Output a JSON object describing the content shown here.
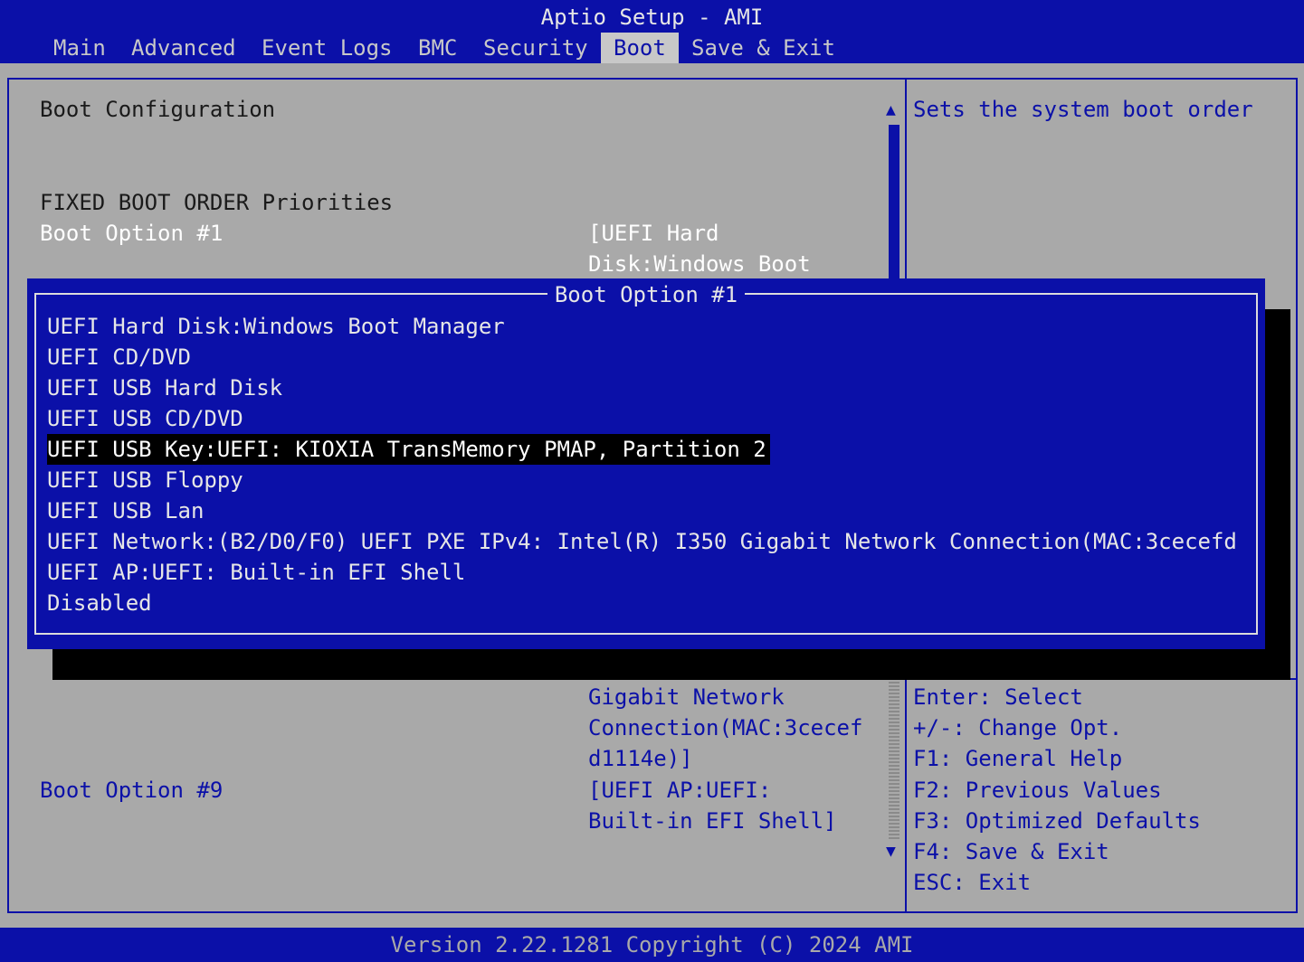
{
  "app_title": "Aptio Setup - AMI",
  "tabs": [
    {
      "label": "Main"
    },
    {
      "label": "Advanced"
    },
    {
      "label": "Event Logs"
    },
    {
      "label": "BMC"
    },
    {
      "label": "Security"
    },
    {
      "label": "Boot"
    },
    {
      "label": "Save & Exit"
    }
  ],
  "active_tab": "Boot",
  "main": {
    "section_title": "Boot Configuration",
    "priorities_heading": "FIXED BOOT ORDER Priorities",
    "boot_option_1_label": "Boot Option #1",
    "boot_option_1_value_line1": "[UEFI Hard",
    "boot_option_1_value_line2": "Disk:Windows Boot",
    "partial_value_line1": "Gigabit Network",
    "partial_value_line2": "Connection(MAC:3cecef",
    "partial_value_line3": "d1114e)]",
    "boot_option_9_label": "Boot Option #9",
    "boot_option_9_value_line1": "[UEFI AP:UEFI:",
    "boot_option_9_value_line2": "Built-in EFI Shell]"
  },
  "help": {
    "description": "Sets the system boot order",
    "keys": [
      "Enter: Select",
      "+/-: Change Opt.",
      "F1: General Help",
      "F2: Previous Values",
      "F3: Optimized Defaults",
      "F4: Save & Exit",
      "ESC: Exit"
    ]
  },
  "popup": {
    "title": "Boot Option #1",
    "options": [
      "UEFI Hard Disk:Windows Boot Manager",
      "UEFI CD/DVD",
      "UEFI USB Hard Disk",
      "UEFI USB CD/DVD",
      "UEFI USB Key:UEFI: KIOXIA TransMemory PMAP, Partition 2",
      "UEFI USB Floppy",
      "UEFI USB Lan",
      "UEFI Network:(B2/D0/F0) UEFI PXE IPv4: Intel(R) I350 Gigabit Network Connection(MAC:3cecefd",
      "UEFI AP:UEFI: Built-in EFI Shell",
      "Disabled"
    ],
    "selected_index": 4
  },
  "scrollbar": {
    "up_arrow": "▲",
    "down_arrow": "▼"
  },
  "footer": "Version 2.22.1281 Copyright (C) 2024 AMI",
  "colors": {
    "background": "#a9a9a9",
    "accent_blue": "#0b10a8",
    "selection": "#000000"
  }
}
